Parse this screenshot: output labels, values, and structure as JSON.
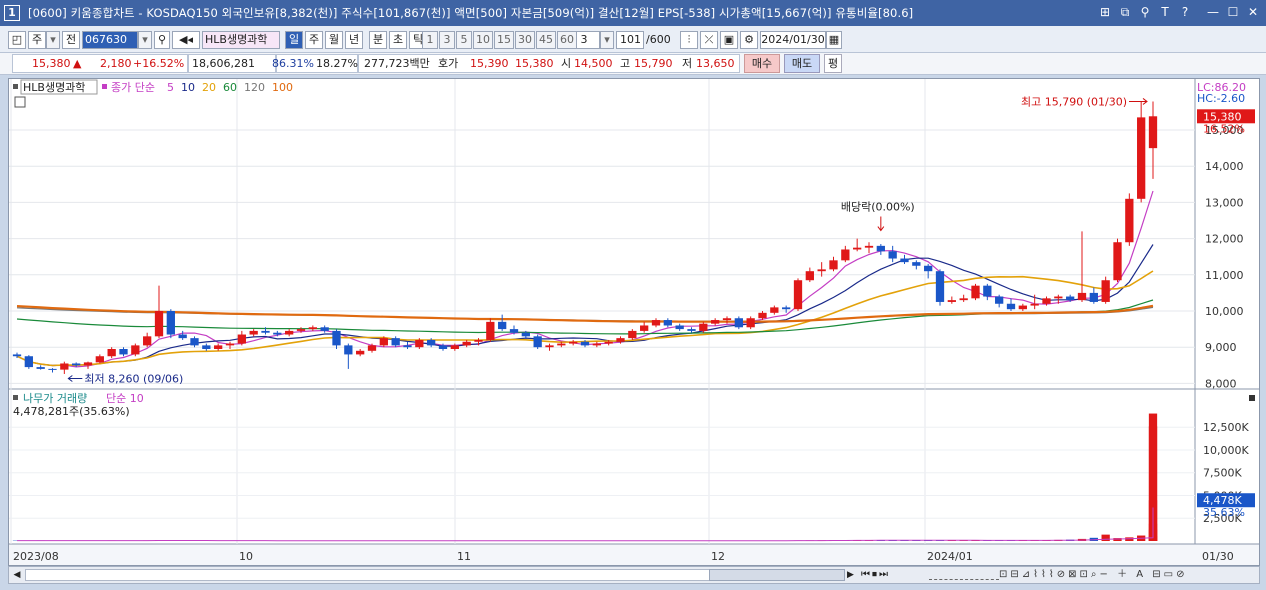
{
  "window": {
    "number": "1",
    "title": "[0600] 키움종합차트 - KOSDAQ150 외국인보유[8,382(천)] 주식수[101,867(천)] 액면[500] 자본금[509(억)] 결산[12월] EPS[-538] 시가총액[15,667(억)] 유통비율[80.6]"
  },
  "toolbar": {
    "market": "주",
    "prev": "전",
    "code": "067630",
    "stock_name": "HLB생명과학",
    "periods": [
      "일",
      "주",
      "월",
      "년",
      "분",
      "초",
      "틱"
    ],
    "active_period": "일",
    "intervals": [
      "1",
      "3",
      "5",
      "10",
      "15",
      "30",
      "45",
      "60"
    ],
    "count_select": "3",
    "bars": "101",
    "bars_total": "/600",
    "date": "2024/01/30"
  },
  "infobar": {
    "price": "15,380",
    "change": "2,180",
    "change_pct": "+16.52%",
    "volume": "18,606,281",
    "vol_ratio": "86.31%",
    "turnover": "18.27%",
    "amount": "277,723백만",
    "quote_label": "호가",
    "ask": "15,390",
    "bid": "15,380",
    "open_label": "시",
    "open": "14,500",
    "high_label": "고",
    "high": "15,790",
    "low_label": "저",
    "low": "13,650",
    "buy": "매수",
    "sell": "매도",
    "eval": "평"
  },
  "chart_data": {
    "type": "candlestick",
    "legend": {
      "name": "HLB생명과학",
      "ma_label": "종가 단순",
      "ma_periods": [
        "5",
        "10",
        "20",
        "60",
        "120",
        "100"
      ]
    },
    "ma_colors": {
      "5": "#c43ec4",
      "10": "#1a2a8a",
      "20": "#e3a20a",
      "60": "#1a8a3a",
      "120": "#777777",
      "100": "#e06a10"
    },
    "price_axis": {
      "min": 8000,
      "max": 15000,
      "ticks": [
        "8,000",
        "9,000",
        "10,000",
        "11,000",
        "12,000",
        "13,000",
        "14,000",
        "15,000"
      ]
    },
    "labels": {
      "lc": "LC:86.20",
      "hc": "HC:-2.60",
      "current": "15,380",
      "current_pct": "16.52%",
      "high_note": "최고 15,790 (01/30)",
      "low_note": "최저 8,260 (09/06)",
      "dividend": "배당락(0.00%)"
    },
    "ohlc": [
      [
        8800,
        8850,
        8700,
        8750
      ],
      [
        8750,
        8780,
        8400,
        8450
      ],
      [
        8450,
        8500,
        8380,
        8400
      ],
      [
        8400,
        8420,
        8300,
        8380
      ],
      [
        8380,
        8600,
        8260,
        8550
      ],
      [
        8550,
        8580,
        8450,
        8500
      ],
      [
        8500,
        8600,
        8400,
        8580
      ],
      [
        8580,
        8800,
        8550,
        8750
      ],
      [
        8750,
        9000,
        8700,
        8950
      ],
      [
        8950,
        9000,
        8750,
        8800
      ],
      [
        8800,
        9100,
        8750,
        9050
      ],
      [
        9050,
        9400,
        9000,
        9300
      ],
      [
        9300,
        10700,
        9250,
        10000
      ],
      [
        10000,
        10050,
        9250,
        9350
      ],
      [
        9350,
        9450,
        9200,
        9250
      ],
      [
        9250,
        9300,
        9000,
        9050
      ],
      [
        9050,
        9100,
        8900,
        8950
      ],
      [
        8950,
        9100,
        8900,
        9050
      ],
      [
        9050,
        9150,
        8950,
        9100
      ],
      [
        9100,
        9450,
        9050,
        9350
      ],
      [
        9350,
        9500,
        9300,
        9450
      ],
      [
        9450,
        9550,
        9350,
        9400
      ],
      [
        9400,
        9450,
        9300,
        9350
      ],
      [
        9350,
        9500,
        9300,
        9450
      ],
      [
        9450,
        9550,
        9400,
        9500
      ],
      [
        9500,
        9600,
        9450,
        9550
      ],
      [
        9550,
        9600,
        9400,
        9450
      ],
      [
        9450,
        9500,
        8950,
        9050
      ],
      [
        9050,
        9100,
        8400,
        8800
      ],
      [
        8800,
        8950,
        8750,
        8900
      ],
      [
        8900,
        9100,
        8850,
        9050
      ],
      [
        9050,
        9300,
        9000,
        9250
      ],
      [
        9250,
        9300,
        9000,
        9050
      ],
      [
        9050,
        9150,
        8950,
        9000
      ],
      [
        9000,
        9250,
        8950,
        9200
      ],
      [
        9200,
        9250,
        9000,
        9050
      ],
      [
        9050,
        9100,
        8900,
        8950
      ],
      [
        8950,
        9100,
        8900,
        9050
      ],
      [
        9050,
        9200,
        9000,
        9150
      ],
      [
        9150,
        9250,
        9050,
        9200
      ],
      [
        9200,
        9800,
        9150,
        9700
      ],
      [
        9700,
        9900,
        9450,
        9500
      ],
      [
        9500,
        9600,
        9350,
        9400
      ],
      [
        9400,
        9450,
        9250,
        9300
      ],
      [
        9300,
        9350,
        8950,
        9000
      ],
      [
        9000,
        9100,
        8900,
        9050
      ],
      [
        9050,
        9150,
        9000,
        9100
      ],
      [
        9100,
        9200,
        9050,
        9150
      ],
      [
        9150,
        9200,
        9000,
        9050
      ],
      [
        9050,
        9150,
        9000,
        9100
      ],
      [
        9100,
        9200,
        9050,
        9150
      ],
      [
        9150,
        9300,
        9100,
        9250
      ],
      [
        9250,
        9500,
        9200,
        9450
      ],
      [
        9450,
        9700,
        9400,
        9600
      ],
      [
        9600,
        9800,
        9550,
        9750
      ],
      [
        9750,
        9800,
        9550,
        9600
      ],
      [
        9600,
        9650,
        9450,
        9500
      ],
      [
        9500,
        9550,
        9400,
        9450
      ],
      [
        9450,
        9700,
        9400,
        9650
      ],
      [
        9650,
        9800,
        9600,
        9750
      ],
      [
        9750,
        9850,
        9650,
        9800
      ],
      [
        9800,
        9850,
        9500,
        9550
      ],
      [
        9550,
        9850,
        9500,
        9800
      ],
      [
        9800,
        10000,
        9750,
        9950
      ],
      [
        9950,
        10150,
        9900,
        10100
      ],
      [
        10100,
        10150,
        9950,
        10050
      ],
      [
        10050,
        10900,
        10000,
        10850
      ],
      [
        10850,
        11200,
        10800,
        11100
      ],
      [
        11100,
        11350,
        10950,
        11150
      ],
      [
        11150,
        11500,
        11100,
        11400
      ],
      [
        11400,
        11800,
        11350,
        11700
      ],
      [
        11700,
        12000,
        11650,
        11750
      ],
      [
        11750,
        11900,
        11600,
        11800
      ],
      [
        11800,
        11850,
        11550,
        11650
      ],
      [
        11650,
        11800,
        11350,
        11450
      ],
      [
        11450,
        11550,
        11300,
        11350
      ],
      [
        11350,
        11400,
        11150,
        11250
      ],
      [
        11250,
        11300,
        10900,
        11100
      ],
      [
        11100,
        11150,
        10150,
        10250
      ],
      [
        10250,
        10400,
        10200,
        10300
      ],
      [
        10300,
        10450,
        10250,
        10350
      ],
      [
        10350,
        10750,
        10300,
        10700
      ],
      [
        10700,
        10750,
        10300,
        10400
      ],
      [
        10400,
        10450,
        10100,
        10200
      ],
      [
        10200,
        10350,
        10000,
        10050
      ],
      [
        10050,
        10200,
        10000,
        10150
      ],
      [
        10150,
        10450,
        10050,
        10200
      ],
      [
        10200,
        10400,
        10150,
        10350
      ],
      [
        10350,
        10450,
        10200,
        10400
      ],
      [
        10400,
        10450,
        10250,
        10300
      ],
      [
        10300,
        12200,
        10250,
        10500
      ],
      [
        10500,
        10650,
        10200,
        10250
      ],
      [
        10250,
        10950,
        10200,
        10850
      ],
      [
        10850,
        12000,
        10800,
        11900
      ],
      [
        11900,
        13250,
        11800,
        13100
      ],
      [
        13100,
        15790,
        13000,
        15350
      ],
      [
        14500,
        15790,
        13650,
        15380
      ]
    ],
    "volume": {
      "label": "나무가 거래량",
      "ma_label": "단순 10",
      "current": "4,478,281주(35.63%)",
      "axis_ticks": [
        "2,500K",
        "5,000K",
        "7,500K",
        "10,000K",
        "12,500K"
      ],
      "current_tag": "4,478K",
      "current_pct": "35.63%",
      "values_k": [
        40,
        40,
        60,
        30,
        40,
        50,
        40,
        50,
        60,
        40,
        50,
        60,
        100,
        40,
        30,
        30,
        40,
        40,
        30,
        40,
        30,
        40,
        30,
        40,
        30,
        30,
        40,
        40,
        50,
        40,
        30,
        40,
        40,
        30,
        30,
        30,
        30,
        40,
        30,
        30,
        40,
        50,
        40,
        30,
        30,
        30,
        40,
        30,
        30,
        30,
        30,
        30,
        40,
        40,
        30,
        30,
        40,
        30,
        30,
        30,
        30,
        40,
        40,
        40,
        50,
        40,
        60,
        70,
        80,
        90,
        90,
        80,
        90,
        70,
        70,
        80,
        90,
        80,
        60,
        60,
        50,
        70,
        60,
        60,
        60,
        80,
        90,
        100,
        120,
        150,
        230,
        350,
        700,
        320,
        400,
        600,
        550,
        1900,
        1250,
        14000,
        12600,
        4478
      ]
    },
    "x_axis": [
      "2023/08",
      "10",
      "11",
      "12",
      "2024/01",
      "01/30"
    ]
  },
  "bottombar": {
    "controls": [
      "◀",
      "▶",
      "⏮",
      "⏸",
      "⏭"
    ]
  }
}
